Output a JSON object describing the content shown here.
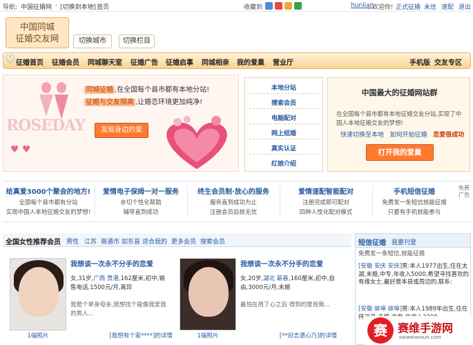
{
  "topbar": {
    "nav_label": "导航:",
    "site": "中国征婚网",
    "sep1": "-",
    "switch_local": "[切换到本地]",
    "sep2": "-",
    "home": "首页",
    "bookmark": "收藏到",
    "user": "hunlian",
    "greeting": ": 欢迎你!",
    "formal": "正式征婚",
    "unread": "未信",
    "matchmaker": "速配",
    "logout": "退出"
  },
  "logo": {
    "line1": "中国同城",
    "line2": "征婚交友网"
  },
  "header": {
    "switch_city": "切换城市",
    "switch_column": "切换栏目"
  },
  "nav": {
    "items": [
      "征婚首页",
      "征婚会员",
      "同城聊天室",
      "征婚广告",
      "征婚启事",
      "同城相亲",
      "我的爱巢",
      "营业厅"
    ],
    "mobile": "手机版",
    "friends": "交友专区"
  },
  "banner": {
    "hl1": "同城征婚",
    "text1": ",在全国每个县市都有本地分站!",
    "hl2": "征婚与交友隔离",
    "text2": ",让婚恋环境更加纯净!",
    "find_button": "发现身边的爱",
    "rose": "ROSEDAY"
  },
  "quick_links": [
    "本地分站",
    "搜索会员",
    "电脑配对",
    "网上结婚",
    "真实认证",
    "红娘介绍"
  ],
  "biggest": {
    "title": "中国最大的征婚网站群",
    "desc": "在全国每个县市都有本地征婚交友分站,实现了中国人本地征婚交友的梦想!",
    "link1": "快速切换至本地",
    "link2": "如何开始征婚",
    "link3": "恋爱很成功",
    "open_button": "打开我的爱巢"
  },
  "features": [
    {
      "title": "给真爱3000个聚会的地方!",
      "line1": "全国每个县市都有分站",
      "line2": "实现中国人本地征婚交友的梦想!"
    },
    {
      "title": "爱情电子保姆一对一服务",
      "line1": "亲切个性化帮助",
      "line2": "辅导直到成功"
    },
    {
      "title": "终生会员制·放心的服务",
      "line1": "服务直到成功为止",
      "line2": "注册会员后就无忧"
    },
    {
      "title": "爱情速配智能配对",
      "line1": "注册完成即可配对",
      "line2": "四种人性化配对模式"
    },
    {
      "title": "手机短信征婚",
      "line1": "免费发一条短信就能征婚",
      "line2": "只要有手机就能参与"
    }
  ],
  "ad_label": "免费广告",
  "female": {
    "heading": "全国女性推荐会员",
    "filters": [
      "男性",
      "江苏",
      "南通市",
      "如东县",
      "适合我的",
      "更多会员",
      "搜索会员"
    ],
    "cards": [
      {
        "title": "我想谈一次永不分手的恋爱",
        "info_a": "女,31岁,",
        "info_city": "广西 贵港",
        "info_b": ",162厘米,初中,销售电话,1500元/月,离异",
        "quote": "我是个单身母亲,我想找个能像我爱我的男人...",
        "photo_caption": "1幅照片",
        "more": "[我想有个家****]的详情"
      },
      {
        "title": "我想谈一次永不分手的恋爱",
        "info_a": "女,20岁,",
        "info_city": "湖北 蕲春",
        "info_b": ",160厘米,初中,自由,3000元/月,未婚",
        "quote": "最怕在用了心之后  得到的是背叛...",
        "photo_caption": "1幅照片",
        "more": "[**旧言遗心乃]的详情"
      }
    ]
  },
  "sms": {
    "heading": "短信征婚",
    "link": "我要刊登",
    "sub": "免费发一条短信,就能征婚",
    "messages": [
      {
        "who": "[安徽 安庆 安庆]",
        "gender": "男",
        "text": ":本人1977出生,住在太湖,未婚,中专,年收入5000,希望寻找喜欢的有缘女士,最好是本县或周边的,联系:"
      },
      {
        "who": "[安徽 蚌埠 蚌埠]",
        "gender": "男",
        "text": ":本人1989年出生,住在怀远县,未婚,中专,年收入3200"
      }
    ]
  },
  "watermark": {
    "title": "赛维手游网",
    "sub": "saiweianxun.com",
    "circle": "赛"
  },
  "colors": {
    "accent": "#ff7a2f",
    "link": "#2a5aa0",
    "nav_bg": "#fbd38f",
    "highlight": "#cc3300"
  }
}
